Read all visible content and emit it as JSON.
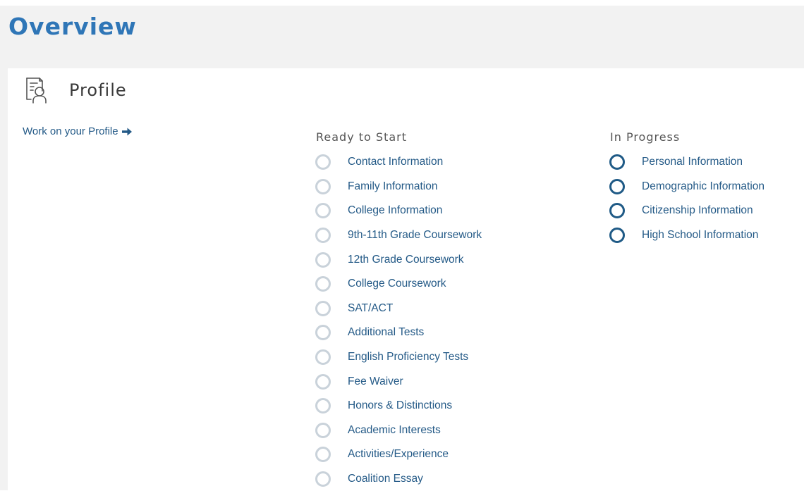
{
  "page": {
    "title": "Overview"
  },
  "profile": {
    "title": "Profile",
    "icon": "profile-document-icon",
    "work_link": "Work on your Profile",
    "work_link_icon": "arrow-right-icon"
  },
  "ready_to_start": {
    "heading": "Ready to Start",
    "items": [
      "Contact Information",
      "Family Information",
      "College Information",
      "9th-11th Grade Coursework",
      "12th Grade Coursework",
      "College Coursework",
      "SAT/ACT",
      "Additional Tests",
      "English Proficiency Tests",
      "Fee Waiver",
      "Honors & Distinctions",
      "Academic Interests",
      "Activities/Experience",
      "Coalition Essay"
    ]
  },
  "in_progress": {
    "heading": "In Progress",
    "items": [
      "Personal Information",
      "Demographic Information",
      "Citizenship Information",
      "High School Information"
    ]
  },
  "colors": {
    "title_blue": "#2f76b7",
    "link_blue": "#245a87",
    "ready_circle": "#c9d2da",
    "progress_circle": "#1f5a86",
    "page_background": "#f2f2f2",
    "card_background": "#ffffff"
  }
}
